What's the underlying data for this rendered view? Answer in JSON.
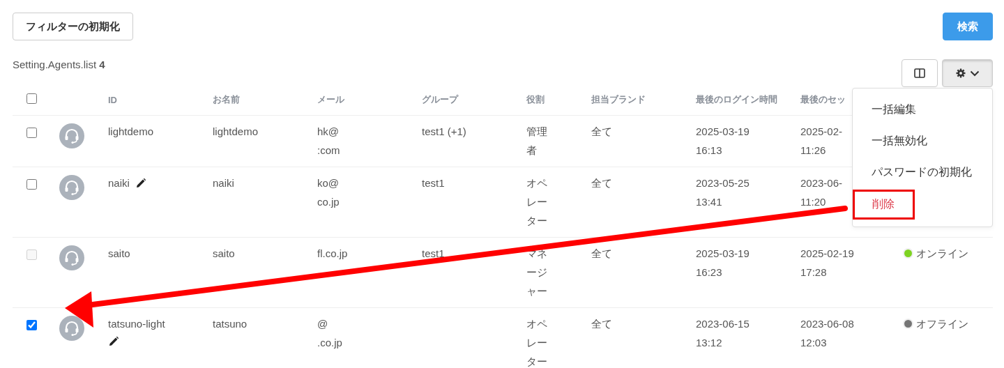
{
  "toolbar": {
    "reset_button": "フィルターの初期化",
    "search_button": "検索"
  },
  "list_title": "Setting.Agents.list **4**",
  "column_toggle": {
    "kind": "columns"
  },
  "actions_menu": {
    "open": true,
    "items": [
      {
        "label": "一括編集",
        "kind": "normal",
        "highlighted": false
      },
      {
        "label": "一括無効化",
        "kind": "normal",
        "highlighted": false
      },
      {
        "label": "パスワードの初期化",
        "kind": "normal",
        "highlighted": false
      },
      {
        "label": "削除",
        "kind": "danger",
        "highlighted": true
      }
    ]
  },
  "arrow_annotation": true,
  "table": {
    "select_all": {
      "checked": false
    },
    "columns": [
      "ID",
      "お名前",
      "メール",
      "グループ",
      "役割",
      "担当ブランド",
      "最後のログイン時間",
      "最後のセッ"
    ],
    "rows": [
      {
        "checked": false,
        "disabled": false,
        "id": "lightdemo",
        "editable": false,
        "name": "lightdemo",
        "mail": [
          "hk@",
          ":com"
        ],
        "group": "test1 (+1)",
        "role": "管理者",
        "brand": "全て",
        "last_login": [
          "2025-03-19",
          "16:13"
        ],
        "last_session": [
          "2025-02-",
          "11:26"
        ]
      },
      {
        "checked": false,
        "disabled": false,
        "id": "naiki",
        "editable": true,
        "name": "naiki",
        "mail": [
          "ko@",
          "co.jp"
        ],
        "group": "test1",
        "role": "オペレーター",
        "brand": "全て",
        "last_login": [
          "2023-05-25",
          "13:41"
        ],
        "last_session": [
          "2023-06-",
          "11:20"
        ]
      },
      {
        "checked": false,
        "disabled": true,
        "id": "saito",
        "editable": false,
        "name": "saito",
        "mail": [
          "fl.co.jp"
        ],
        "group": "test1",
        "role": "マネージャー",
        "brand": "全て",
        "last_login": [
          "2025-03-19",
          "16:23"
        ],
        "last_session": [
          "2025-02-19",
          "17:28"
        ],
        "status": {
          "label": "オンライン",
          "color": "#7ed321"
        }
      },
      {
        "checked": true,
        "disabled": false,
        "id": "tatsuno-light",
        "editable": true,
        "name": "tatsuno",
        "mail": [
          "@",
          ".co.jp"
        ],
        "role": "オペレーター",
        "brand": "全て",
        "last_login": [
          "2023-06-15",
          "13:12"
        ],
        "last_session": [
          "2023-06-08",
          "12:03"
        ],
        "status": {
          "label": "オフライン",
          "color": "#757575"
        }
      }
    ]
  }
}
